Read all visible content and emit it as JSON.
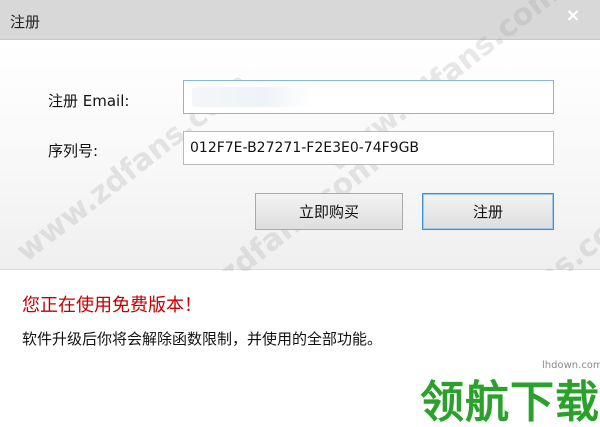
{
  "window": {
    "title": "注册",
    "close_label": "×"
  },
  "form": {
    "email_label": "注册 Email:",
    "email_value": "",
    "serial_label": "序列号:",
    "serial_value": "012F7E-B27271-F2E3E0-74F9GB"
  },
  "buttons": {
    "buy_label": "立即购买",
    "register_label": "注册"
  },
  "notice": {
    "warning": "您正在使用免费版本！",
    "info": "软件升级后你将会解除函数限制，并使用的全部功能。"
  },
  "watermark": {
    "text": "www.zdfans.com",
    "site_logo": "领航下载",
    "site_url": "lhdown.com"
  },
  "colors": {
    "warning": "#c40000",
    "logo": "#2aa12a",
    "accent_border": "#3c8fd4"
  }
}
